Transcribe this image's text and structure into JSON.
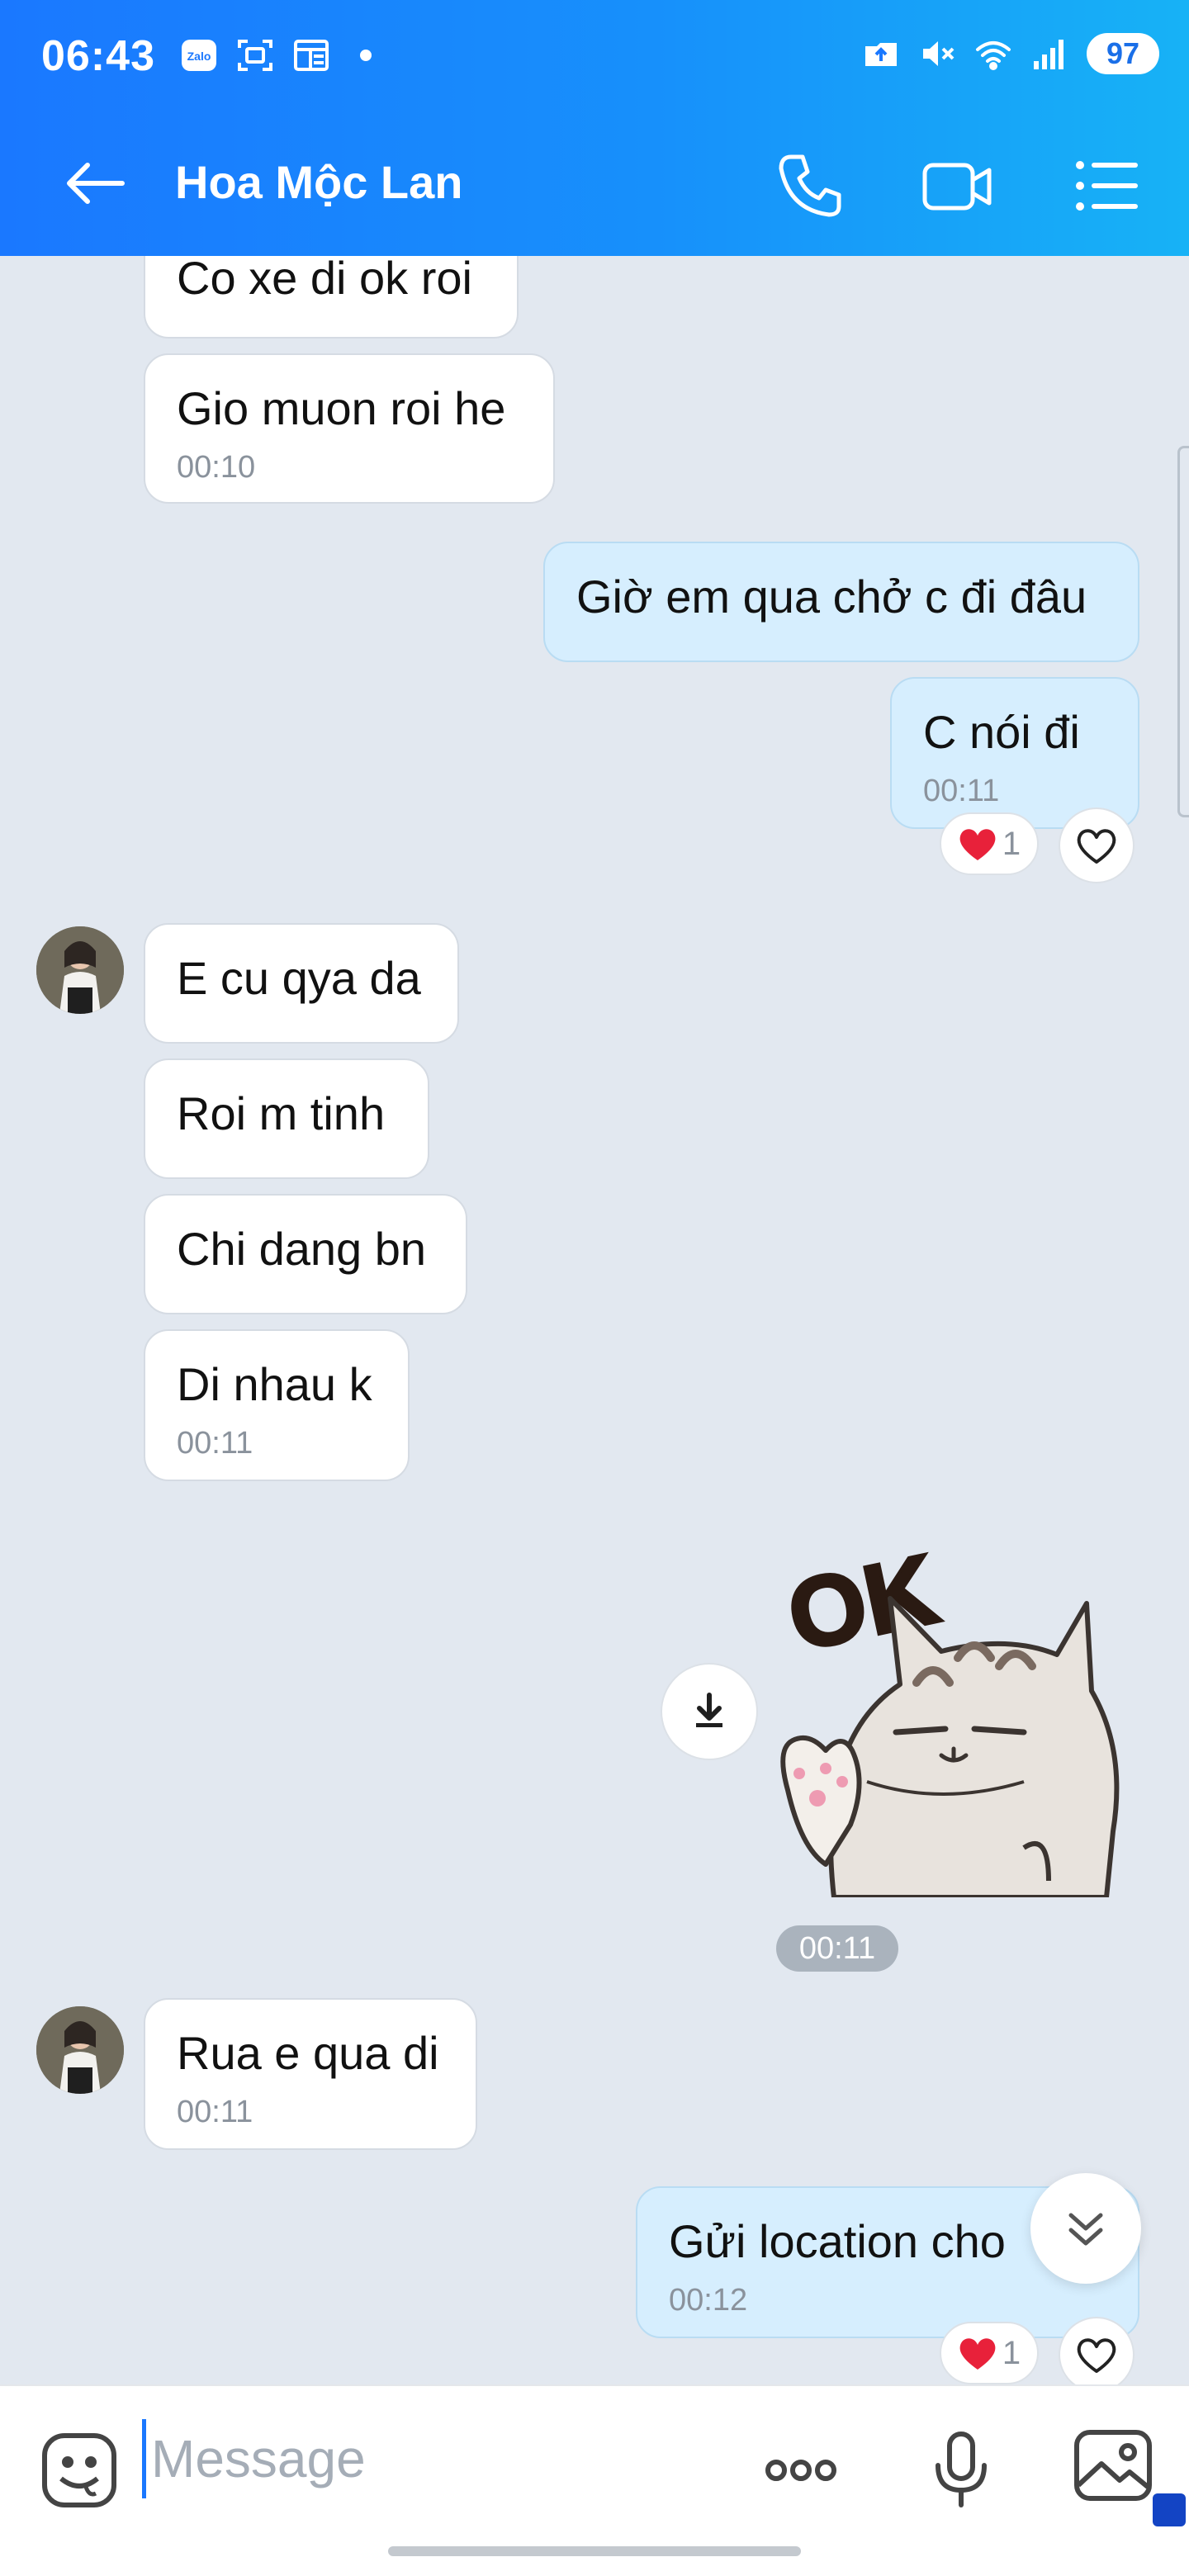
{
  "status_bar": {
    "time": "06:43",
    "battery": "97",
    "left_icons": [
      "zalo-icon",
      "screenshot-icon",
      "news-icon"
    ],
    "right_icons": [
      "upload-icon",
      "mute-icon",
      "wifi-icon",
      "signal-icon"
    ]
  },
  "header": {
    "contact_name": "Hoa Mộc Lan",
    "actions": [
      "phone-icon",
      "video-call-icon",
      "menu-list-icon"
    ]
  },
  "messages": [
    {
      "side": "in",
      "text": "Co xe di ok roi",
      "time": ""
    },
    {
      "side": "in",
      "text": "Gio muon roi he",
      "time": "00:10"
    },
    {
      "side": "out",
      "text": "Giờ em qua chở c đi đâu",
      "time": ""
    },
    {
      "side": "out",
      "text": "C nói đi",
      "time": "00:11",
      "reaction": {
        "emoji": "heart",
        "count": "1"
      }
    },
    {
      "side": "in",
      "text": "E cu qya da",
      "time": ""
    },
    {
      "side": "in",
      "text": "Roi m tinh",
      "time": ""
    },
    {
      "side": "in",
      "text": "Chi dang bn",
      "time": ""
    },
    {
      "side": "in",
      "text": "Di nhau k",
      "time": "00:11"
    },
    {
      "side": "out",
      "type": "sticker",
      "sticker_text": "OK",
      "time": "00:11"
    },
    {
      "side": "in",
      "text": "Rua e qua di",
      "time": "00:11"
    },
    {
      "side": "out",
      "text": "Gửi location cho",
      "time": "00:12",
      "reaction": {
        "emoji": "heart",
        "count": "1"
      }
    }
  ],
  "composer": {
    "placeholder": "Message",
    "icons": [
      "emoji-icon",
      "more-icon",
      "microphone-icon",
      "image-icon"
    ]
  },
  "colors": {
    "header_start": "#1a78ff",
    "header_end": "#17b2f6",
    "background": "#e2e8f0",
    "outgoing_bubble": "#d6eefe",
    "incoming_bubble": "#ffffff",
    "heart": "#e8213a"
  }
}
